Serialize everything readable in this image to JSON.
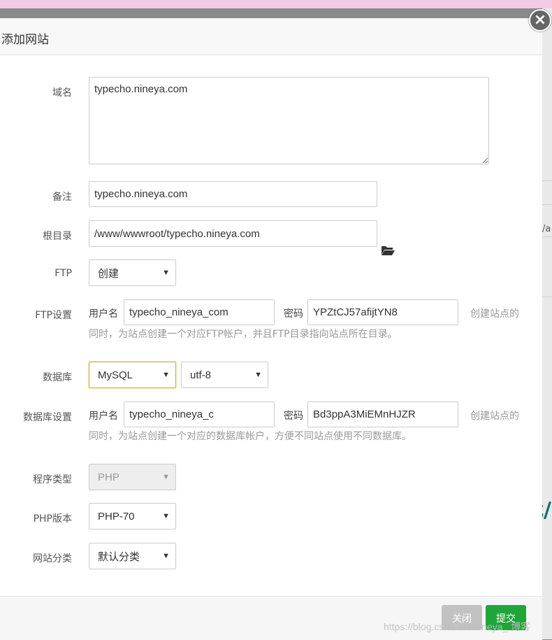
{
  "dialog": {
    "title": "添加网站",
    "close_glyph": "×"
  },
  "form": {
    "domain": {
      "label": "域名",
      "value": "typecho.nineya.com"
    },
    "remark": {
      "label": "备注",
      "value": "typecho.nineya.com"
    },
    "root_dir": {
      "label": "根目录",
      "value": "/www/wwwroot/typecho.nineya.com",
      "icon": "folder-open-icon"
    },
    "ftp": {
      "label": "FTP",
      "selected": "创建"
    },
    "ftp_settings": {
      "label": "FTP设置",
      "user_label": "用户名",
      "user_value": "typecho_nineya_com",
      "pass_label": "密码",
      "pass_value": "YPZtCJ57afijtYN8",
      "hint_line1": "创建站点的",
      "hint_line2": "同时，为站点创建一个对应FTP帐户，并且FTP目录指向站点所在目录。"
    },
    "database": {
      "label": "数据库",
      "type_selected": "MySQL",
      "charset_selected": "utf-8"
    },
    "db_settings": {
      "label": "数据库设置",
      "user_label": "用户名",
      "user_value": "typecho_nineya_c",
      "pass_label": "密码",
      "pass_value": "Bd3ppA3MiEMnHJZR",
      "hint_line1": "创建站点的",
      "hint_line2": "同时，为站点创建一个对应的数据库帐户，方便不同站点使用不同数据库。"
    },
    "program_type": {
      "label": "程序类型",
      "selected": "PHP"
    },
    "php_version": {
      "label": "PHP版本",
      "selected": "PHP-70"
    },
    "site_category": {
      "label": "网站分类",
      "selected": "默认分类"
    }
  },
  "footer": {
    "close_label": "关闭",
    "submit_label": "提交"
  },
  "background": {
    "side_text": "/a",
    "deco_text": "我/"
  },
  "watermark": "https://blog.csdn.net/nineya_ 博客",
  "colors": {
    "submit": "#20a53a",
    "close": "#c2c2c2",
    "focus_border": "#d4a83a",
    "topbar": "#f3cbe6"
  }
}
